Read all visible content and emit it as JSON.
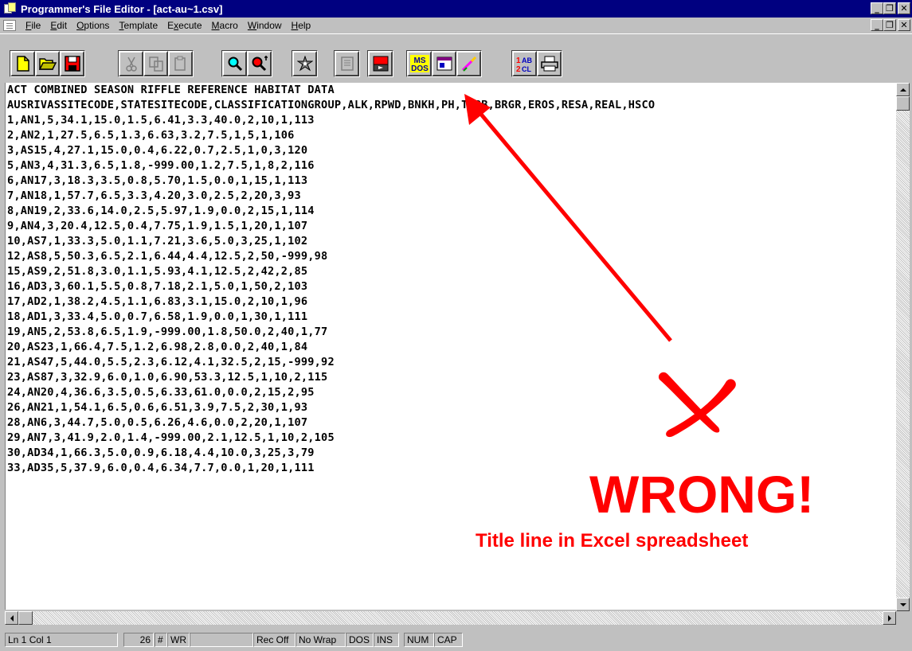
{
  "window": {
    "title": "Programmer's File Editor - [act-au~1.csv]",
    "title_bar_color": "#000080"
  },
  "menu": {
    "items": [
      {
        "pre": "",
        "key": "F",
        "post": "ile"
      },
      {
        "pre": "",
        "key": "E",
        "post": "dit"
      },
      {
        "pre": "",
        "key": "O",
        "post": "ptions"
      },
      {
        "pre": "",
        "key": "T",
        "post": "emplate"
      },
      {
        "pre": "E",
        "key": "x",
        "post": "ecute"
      },
      {
        "pre": "",
        "key": "M",
        "post": "acro"
      },
      {
        "pre": "",
        "key": "W",
        "post": "indow"
      },
      {
        "pre": "",
        "key": "H",
        "post": "elp"
      }
    ]
  },
  "toolbar": {
    "buttons": [
      {
        "name": "new-file-icon"
      },
      {
        "name": "open-folder-icon"
      },
      {
        "name": "save-disk-icon"
      },
      {
        "name": "cut-icon"
      },
      {
        "name": "copy-icon"
      },
      {
        "name": "paste-icon"
      },
      {
        "name": "find-icon"
      },
      {
        "name": "find-next-icon"
      },
      {
        "name": "execute-icon"
      },
      {
        "name": "template-icon"
      },
      {
        "name": "record-macro-icon"
      },
      {
        "name": "msdos-icon"
      },
      {
        "name": "window-icon"
      },
      {
        "name": "tools-icon"
      },
      {
        "name": "sort-icon"
      },
      {
        "name": "print-icon"
      }
    ],
    "msdos_label": "MS DOS",
    "sort_label": "1AB 2CL"
  },
  "editor": {
    "lines": [
      "ACT COMBINED SEASON RIFFLE REFERENCE HABITAT DATA",
      "AUSRIVASSITECODE,STATESITECODE,CLASSIFICATIONGROUP,ALK,RPWD,BNKH,PH,TURB,BRGR,EROS,RESA,REAL,HSCO",
      "1,AN1,5,34.1,15.0,1.5,6.41,3.3,40.0,2,10,1,113",
      "2,AN2,1,27.5,6.5,1.3,6.63,3.2,7.5,1,5,1,106",
      "3,AS15,4,27.1,15.0,0.4,6.22,0.7,2.5,1,0,3,120",
      "5,AN3,4,31.3,6.5,1.8,-999.00,1.2,7.5,1,8,2,116",
      "6,AN17,3,18.3,3.5,0.8,5.70,1.5,0.0,1,15,1,113",
      "7,AN18,1,57.7,6.5,3.3,4.20,3.0,2.5,2,20,3,93",
      "8,AN19,2,33.6,14.0,2.5,5.97,1.9,0.0,2,15,1,114",
      "9,AN4,3,20.4,12.5,0.4,7.75,1.9,1.5,1,20,1,107",
      "10,AS7,1,33.3,5.0,1.1,7.21,3.6,5.0,3,25,1,102",
      "12,AS8,5,50.3,6.5,2.1,6.44,4.4,12.5,2,50,-999,98",
      "15,AS9,2,51.8,3.0,1.1,5.93,4.1,12.5,2,42,2,85",
      "16,AD3,3,60.1,5.5,0.8,7.18,2.1,5.0,1,50,2,103",
      "17,AD2,1,38.2,4.5,1.1,6.83,3.1,15.0,2,10,1,96",
      "18,AD1,3,33.4,5.0,0.7,6.58,1.9,0.0,1,30,1,111",
      "19,AN5,2,53.8,6.5,1.9,-999.00,1.8,50.0,2,40,1,77",
      "20,AS23,1,66.4,7.5,1.2,6.98,2.8,0.0,2,40,1,84",
      "21,AS47,5,44.0,5.5,2.3,6.12,4.1,32.5,2,15,-999,92",
      "23,AS87,3,32.9,6.0,1.0,6.90,53.3,12.5,1,10,2,115",
      "24,AN20,4,36.6,3.5,0.5,6.33,61.0,0.0,2,15,2,95",
      "26,AN21,1,54.1,6.5,0.6,6.51,3.9,7.5,2,30,1,93",
      "28,AN6,3,44.7,5.0,0.5,6.26,4.6,0.0,2,20,1,107",
      "29,AN7,3,41.9,2.0,1.4,-999.00,2.1,12.5,1,10,2,105",
      "30,AD34,1,66.3,5.0,0.9,6.18,4.4,10.0,3,25,3,79",
      "33,AD35,5,37.9,6.0,0.4,6.34,7.7,0.0,1,20,1,111"
    ]
  },
  "statusbar": {
    "position": "Ln 1 Col 1",
    "number": "26",
    "hash": "#",
    "wr": "WR",
    "rec": "Rec Off",
    "wrap": "No Wrap",
    "dos": "DOS",
    "ins": "INS",
    "num": "NUM",
    "cap": "CAP"
  },
  "annotation": {
    "headline": "WRONG!",
    "caption": "Title line in Excel spreadsheet",
    "color": "#ff0000",
    "cross_icon": "x-mark-icon"
  }
}
